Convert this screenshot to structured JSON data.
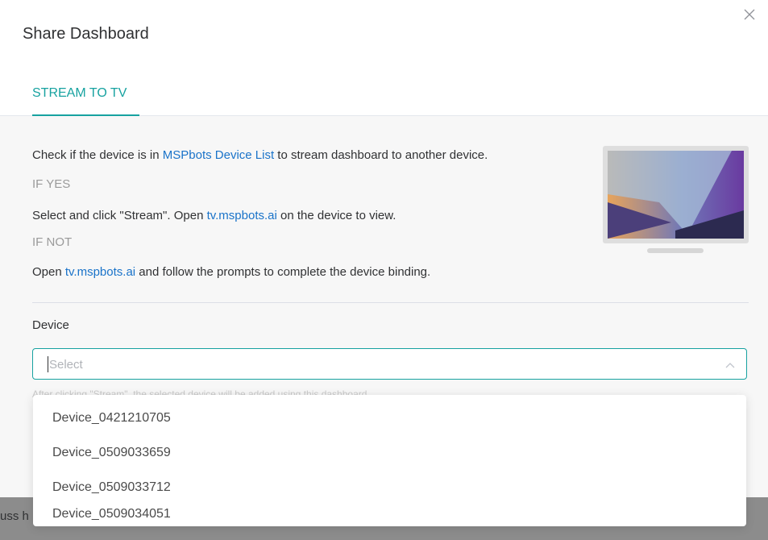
{
  "dialog": {
    "title": "Share Dashboard",
    "close_icon": "close-icon"
  },
  "tabs": [
    {
      "label": "STREAM TO TV",
      "active": true
    }
  ],
  "instructions": {
    "line1_prefix": "Check if the device is in ",
    "line1_link": "MSPbots Device List",
    "line1_suffix": " to stream dashboard to another device.",
    "if_yes": "IF YES",
    "line2_prefix": "Select and click \"Stream\". Open ",
    "line2_link": "tv.mspbots.ai",
    "line2_suffix": " on the device to view.",
    "if_not": "IF NOT",
    "line3_prefix": "Open ",
    "line3_link": "tv.mspbots.ai",
    "line3_suffix": " and follow the prompts to complete the device binding."
  },
  "illustration": "tv-illustration",
  "device": {
    "label": "Device",
    "placeholder": "Select",
    "arrow_icon": "chevron-up-icon",
    "hint": "After clicking \"Stream\", the selected device will be added using this dashboard."
  },
  "dropdown": {
    "options": [
      "Device_0421210705",
      "Device_0509033659",
      "Device_0509033712",
      "Device_0509034051"
    ]
  },
  "background": {
    "partial_text": "uss h"
  },
  "colors": {
    "accent": "#17a2a0",
    "link": "#1a73c9",
    "muted": "#9a9a9a"
  }
}
